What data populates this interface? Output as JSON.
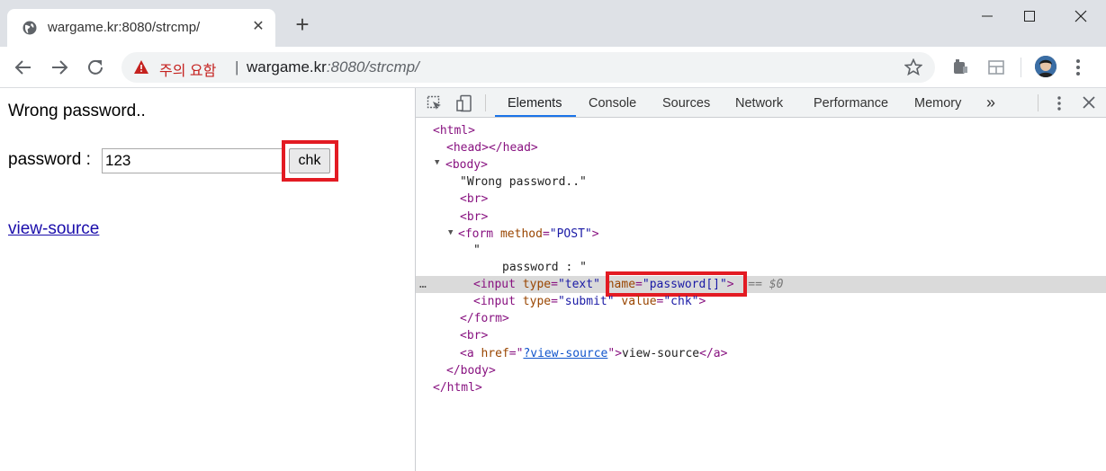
{
  "tab": {
    "title": "wargame.kr:8080/strcmp/",
    "favicon": "globe-icon",
    "close": "✕"
  },
  "new_tab": "+",
  "omnibox": {
    "warning": "주의 요함",
    "separator": "|",
    "url_host": "wargame.kr",
    "url_path": ":8080/strcmp/"
  },
  "page": {
    "message": "Wrong password..",
    "password_label": "password :",
    "password_value": "123",
    "submit_label": "chk",
    "view_source": "view-source"
  },
  "devtools": {
    "tabs": [
      "Elements",
      "Console",
      "Sources",
      "Network",
      "Performance",
      "Memory"
    ],
    "more": "»",
    "active_tab": "Elements",
    "dom": {
      "html_open": "<html>",
      "head": "<head></head>",
      "body_open": "<body>",
      "text_wrong": "\"Wrong password..\"",
      "br": "<br>",
      "form_open_tag": "<form ",
      "form_attr": "method",
      "form_val": "\"POST\"",
      "quote": "\"",
      "text_password": "password : \"",
      "input_tag": "<input ",
      "type_attr": "type",
      "type_text_val": "\"text\"",
      "name_attr": "name",
      "name_val": "\"password[]\"",
      "selected_marker": "== $0",
      "ellipsis": "…",
      "submit_type_val": "\"submit\"",
      "value_attr": "value",
      "value_val": "\"chk\"",
      "form_close": "</form>",
      "a_tag": "<a ",
      "href_attr": "href",
      "href_val": "?view-source",
      "a_text": "view-source",
      "a_close": "</a>",
      "body_close": "</body>",
      "html_close": "</html>"
    }
  },
  "colors": {
    "highlight_box": "#e31b23",
    "tag": "#881280",
    "attr": "#994500",
    "value": "#1a1aa6",
    "warning": "#c5221f",
    "active_tab_underline": "#1a73e8"
  }
}
